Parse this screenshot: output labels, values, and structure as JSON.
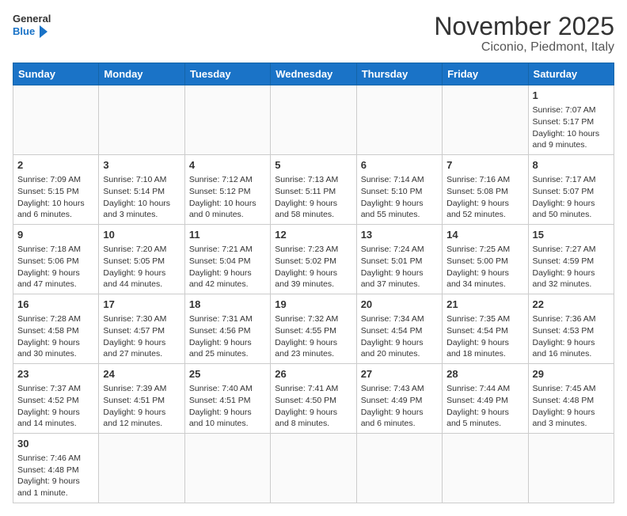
{
  "header": {
    "logo_general": "General",
    "logo_blue": "Blue",
    "title": "November 2025",
    "subtitle": "Ciconio, Piedmont, Italy"
  },
  "days_of_week": [
    "Sunday",
    "Monday",
    "Tuesday",
    "Wednesday",
    "Thursday",
    "Friday",
    "Saturday"
  ],
  "rows": [
    [
      {
        "day": "",
        "info": ""
      },
      {
        "day": "",
        "info": ""
      },
      {
        "day": "",
        "info": ""
      },
      {
        "day": "",
        "info": ""
      },
      {
        "day": "",
        "info": ""
      },
      {
        "day": "",
        "info": ""
      },
      {
        "day": "1",
        "info": "Sunrise: 7:07 AM\nSunset: 5:17 PM\nDaylight: 10 hours and 9 minutes."
      }
    ],
    [
      {
        "day": "2",
        "info": "Sunrise: 7:09 AM\nSunset: 5:15 PM\nDaylight: 10 hours and 6 minutes."
      },
      {
        "day": "3",
        "info": "Sunrise: 7:10 AM\nSunset: 5:14 PM\nDaylight: 10 hours and 3 minutes."
      },
      {
        "day": "4",
        "info": "Sunrise: 7:12 AM\nSunset: 5:12 PM\nDaylight: 10 hours and 0 minutes."
      },
      {
        "day": "5",
        "info": "Sunrise: 7:13 AM\nSunset: 5:11 PM\nDaylight: 9 hours and 58 minutes."
      },
      {
        "day": "6",
        "info": "Sunrise: 7:14 AM\nSunset: 5:10 PM\nDaylight: 9 hours and 55 minutes."
      },
      {
        "day": "7",
        "info": "Sunrise: 7:16 AM\nSunset: 5:08 PM\nDaylight: 9 hours and 52 minutes."
      },
      {
        "day": "8",
        "info": "Sunrise: 7:17 AM\nSunset: 5:07 PM\nDaylight: 9 hours and 50 minutes."
      }
    ],
    [
      {
        "day": "9",
        "info": "Sunrise: 7:18 AM\nSunset: 5:06 PM\nDaylight: 9 hours and 47 minutes."
      },
      {
        "day": "10",
        "info": "Sunrise: 7:20 AM\nSunset: 5:05 PM\nDaylight: 9 hours and 44 minutes."
      },
      {
        "day": "11",
        "info": "Sunrise: 7:21 AM\nSunset: 5:04 PM\nDaylight: 9 hours and 42 minutes."
      },
      {
        "day": "12",
        "info": "Sunrise: 7:23 AM\nSunset: 5:02 PM\nDaylight: 9 hours and 39 minutes."
      },
      {
        "day": "13",
        "info": "Sunrise: 7:24 AM\nSunset: 5:01 PM\nDaylight: 9 hours and 37 minutes."
      },
      {
        "day": "14",
        "info": "Sunrise: 7:25 AM\nSunset: 5:00 PM\nDaylight: 9 hours and 34 minutes."
      },
      {
        "day": "15",
        "info": "Sunrise: 7:27 AM\nSunset: 4:59 PM\nDaylight: 9 hours and 32 minutes."
      }
    ],
    [
      {
        "day": "16",
        "info": "Sunrise: 7:28 AM\nSunset: 4:58 PM\nDaylight: 9 hours and 30 minutes."
      },
      {
        "day": "17",
        "info": "Sunrise: 7:30 AM\nSunset: 4:57 PM\nDaylight: 9 hours and 27 minutes."
      },
      {
        "day": "18",
        "info": "Sunrise: 7:31 AM\nSunset: 4:56 PM\nDaylight: 9 hours and 25 minutes."
      },
      {
        "day": "19",
        "info": "Sunrise: 7:32 AM\nSunset: 4:55 PM\nDaylight: 9 hours and 23 minutes."
      },
      {
        "day": "20",
        "info": "Sunrise: 7:34 AM\nSunset: 4:54 PM\nDaylight: 9 hours and 20 minutes."
      },
      {
        "day": "21",
        "info": "Sunrise: 7:35 AM\nSunset: 4:54 PM\nDaylight: 9 hours and 18 minutes."
      },
      {
        "day": "22",
        "info": "Sunrise: 7:36 AM\nSunset: 4:53 PM\nDaylight: 9 hours and 16 minutes."
      }
    ],
    [
      {
        "day": "23",
        "info": "Sunrise: 7:37 AM\nSunset: 4:52 PM\nDaylight: 9 hours and 14 minutes."
      },
      {
        "day": "24",
        "info": "Sunrise: 7:39 AM\nSunset: 4:51 PM\nDaylight: 9 hours and 12 minutes."
      },
      {
        "day": "25",
        "info": "Sunrise: 7:40 AM\nSunset: 4:51 PM\nDaylight: 9 hours and 10 minutes."
      },
      {
        "day": "26",
        "info": "Sunrise: 7:41 AM\nSunset: 4:50 PM\nDaylight: 9 hours and 8 minutes."
      },
      {
        "day": "27",
        "info": "Sunrise: 7:43 AM\nSunset: 4:49 PM\nDaylight: 9 hours and 6 minutes."
      },
      {
        "day": "28",
        "info": "Sunrise: 7:44 AM\nSunset: 4:49 PM\nDaylight: 9 hours and 5 minutes."
      },
      {
        "day": "29",
        "info": "Sunrise: 7:45 AM\nSunset: 4:48 PM\nDaylight: 9 hours and 3 minutes."
      }
    ],
    [
      {
        "day": "30",
        "info": "Sunrise: 7:46 AM\nSunset: 4:48 PM\nDaylight: 9 hours and 1 minute."
      },
      {
        "day": "",
        "info": ""
      },
      {
        "day": "",
        "info": ""
      },
      {
        "day": "",
        "info": ""
      },
      {
        "day": "",
        "info": ""
      },
      {
        "day": "",
        "info": ""
      },
      {
        "day": "",
        "info": ""
      }
    ]
  ]
}
